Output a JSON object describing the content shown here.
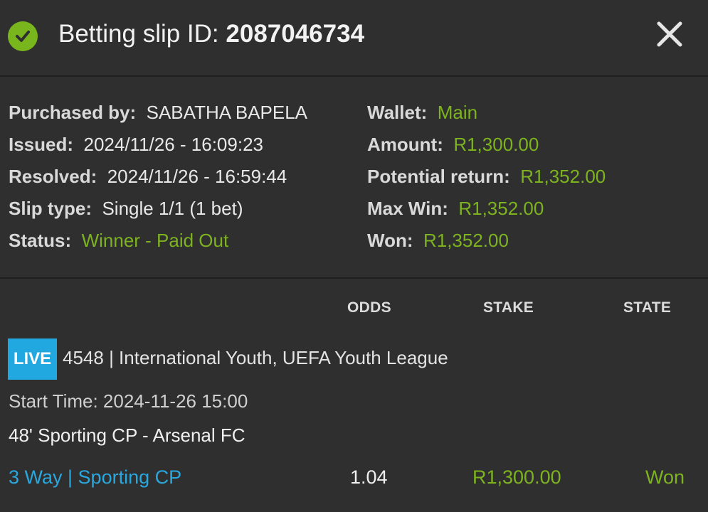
{
  "header": {
    "title_prefix": "Betting slip ID:",
    "slip_id": "2087046734",
    "status_icon": "check-circle-icon",
    "close_icon": "close-icon"
  },
  "info_left": [
    {
      "key": "Purchased by:",
      "value": "SABATHA BAPELA",
      "highlight": false
    },
    {
      "key": "Issued:",
      "value": "2024/11/26 - 16:09:23",
      "highlight": false
    },
    {
      "key": "Resolved:",
      "value": "2024/11/26 - 16:59:44",
      "highlight": false
    },
    {
      "key": "Slip type:",
      "value": "Single 1/1 (1 bet)",
      "highlight": false
    },
    {
      "key": "Status:",
      "value": "Winner - Paid Out",
      "highlight": true
    }
  ],
  "info_right": [
    {
      "key": "Wallet:",
      "value": "Main"
    },
    {
      "key": "Amount:",
      "value": "R1,300.00"
    },
    {
      "key": "Potential return:",
      "value": "R1,352.00"
    },
    {
      "key": "Max Win:",
      "value": "R1,352.00"
    },
    {
      "key": "Won:",
      "value": "R1,352.00"
    }
  ],
  "columns": {
    "odds": "ODDS",
    "stake": "STAKE",
    "state": "STATE"
  },
  "bet": {
    "live_badge": "LIVE",
    "league": "4548 | International Youth, UEFA Youth League",
    "start_time": "Start Time: 2024-11-26 15:00",
    "match": "48' Sporting CP - Arsenal FC",
    "market": "3 Way |",
    "selection": "Sporting CP",
    "odds": "1.04",
    "stake": "R1,300.00",
    "state": "Won"
  },
  "colors": {
    "accent_green": "#7db31f",
    "live_blue": "#22a8e0",
    "background": "#2f2f2f"
  }
}
